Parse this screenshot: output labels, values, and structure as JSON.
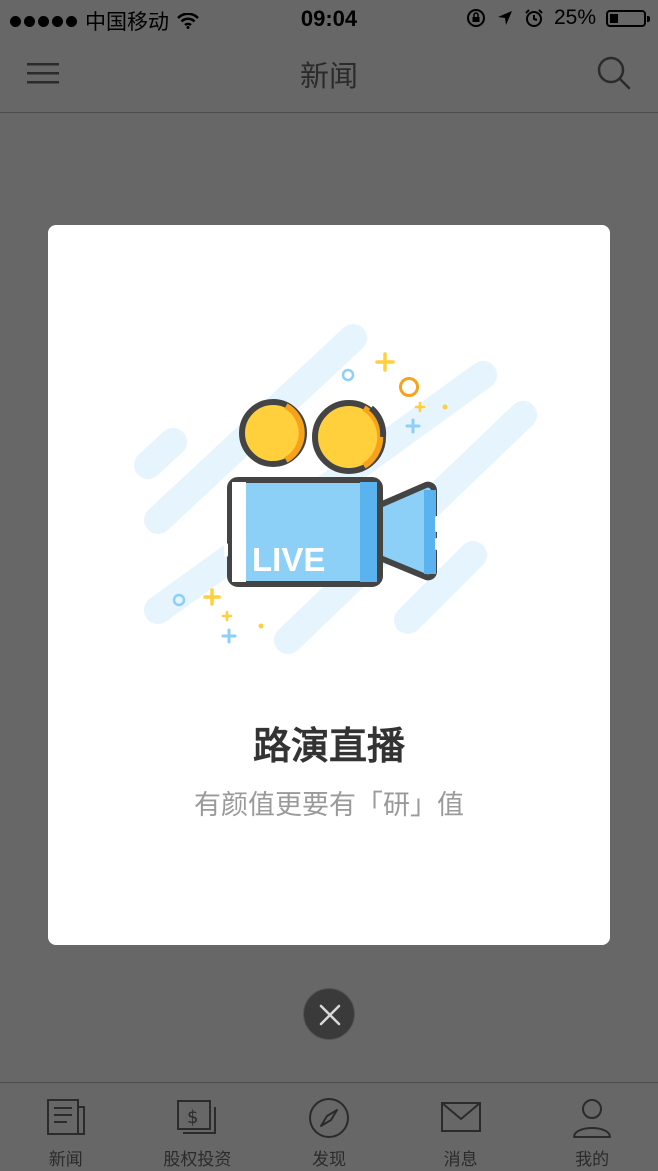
{
  "status_bar": {
    "carrier": "中国移动",
    "time": "09:04",
    "battery": "25%",
    "battery_level": 0.25
  },
  "header": {
    "title": "新闻"
  },
  "modal": {
    "badge_text": "LIVE",
    "title": "路演直播",
    "subtitle": "有颜值更要有「研」值"
  },
  "tabbar": {
    "items": [
      {
        "label": "新闻",
        "icon": "newspaper-icon"
      },
      {
        "label": "股权投资",
        "icon": "dollar-document-icon"
      },
      {
        "label": "发现",
        "icon": "compass-icon"
      },
      {
        "label": "消息",
        "icon": "envelope-icon"
      },
      {
        "label": "我的",
        "icon": "user-icon"
      }
    ]
  },
  "colors": {
    "overlay": "#676767",
    "accent_blue": "#8ccff7",
    "accent_yellow": "#ffd03c",
    "accent_orange": "#f6a21b",
    "outline": "#444444"
  }
}
